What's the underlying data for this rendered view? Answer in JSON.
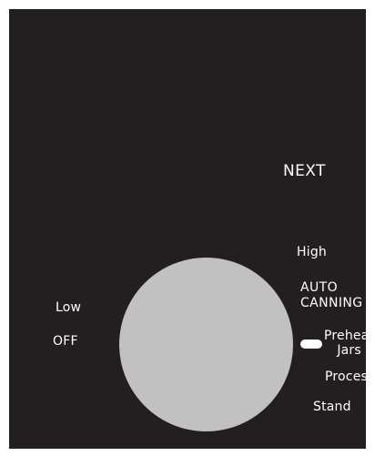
{
  "panel": {
    "next_label": "NEXT",
    "positions": {
      "high": "High",
      "auto_canning": "AUTO\nCANNING",
      "low": "Low",
      "off": "OFF",
      "preheat_jars": "Preheat\nJars",
      "process": "Process",
      "stand": "Stand"
    },
    "selected_position": "Preheat Jars",
    "colors": {
      "panel_background": "#231f20",
      "knob": "#c1c1c1",
      "text": "#ffffff",
      "indicator": "#ffffff"
    }
  }
}
